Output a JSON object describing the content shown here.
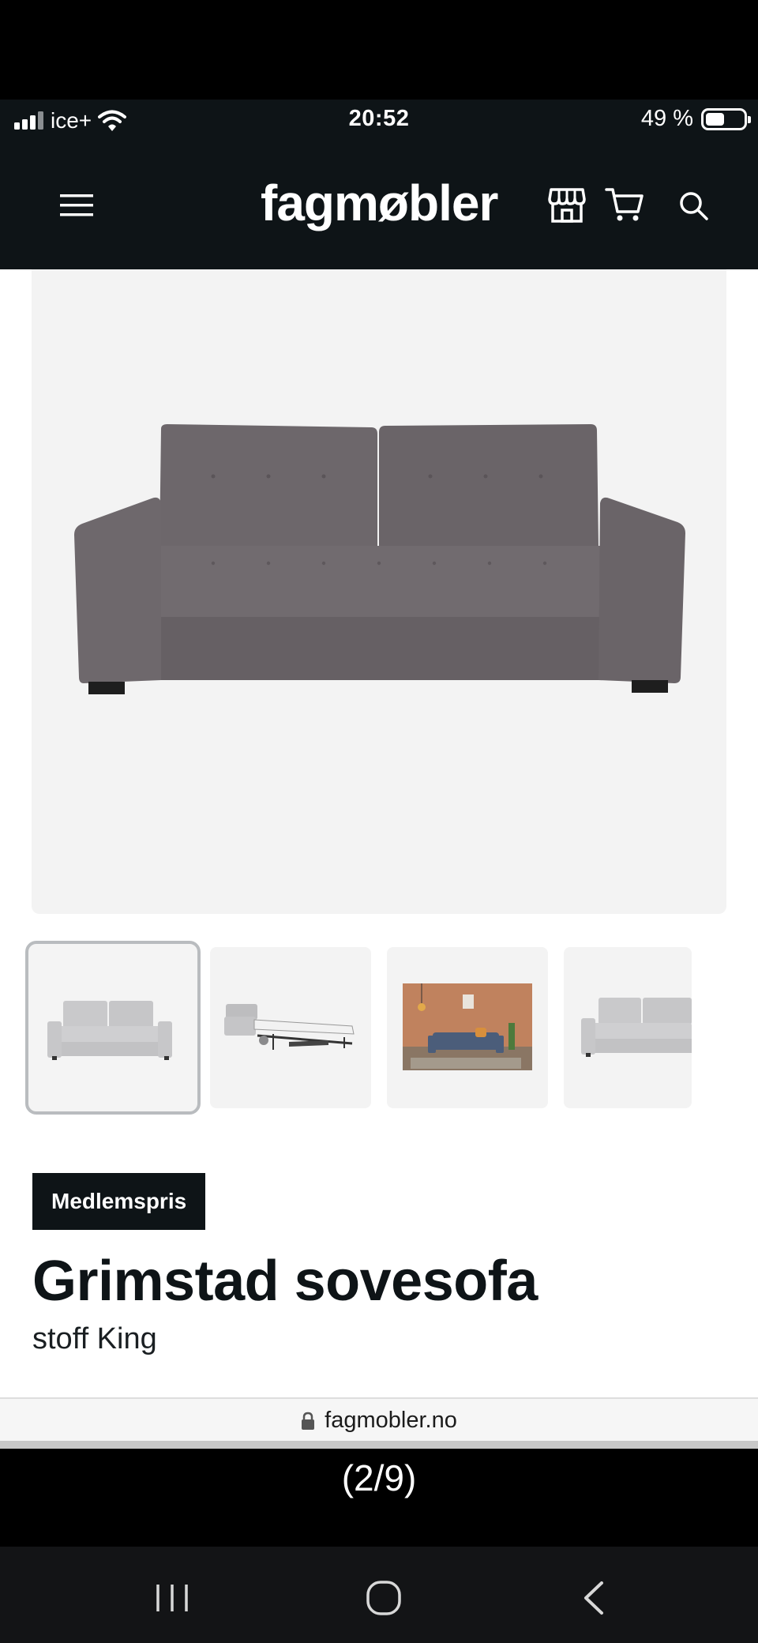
{
  "status_bar": {
    "carrier": "ice+",
    "time": "20:52",
    "battery": "49 %",
    "battery_level": 0.49
  },
  "header": {
    "logo": "fagmøbler",
    "icons": [
      "menu-icon",
      "store-icon",
      "cart-icon",
      "search-icon"
    ]
  },
  "product": {
    "badge": "Medlemspris",
    "title": "Grimstad sovesofa",
    "subtitle": "stoff King",
    "thumbnails": [
      {
        "label": "sofa-front",
        "selected": true
      },
      {
        "label": "sofa-bed-open",
        "selected": false
      },
      {
        "label": "sofa-room-scene",
        "selected": false
      },
      {
        "label": "sofa-front-alt",
        "selected": false
      }
    ]
  },
  "browser": {
    "url": "fagmobler.no"
  },
  "viewer": {
    "counter": "(2/9)"
  },
  "colors": {
    "header_bg": "#0e1417",
    "badge_bg": "#0e1417",
    "sofa": "#6a6468",
    "image_bg": "#f3f3f3"
  }
}
